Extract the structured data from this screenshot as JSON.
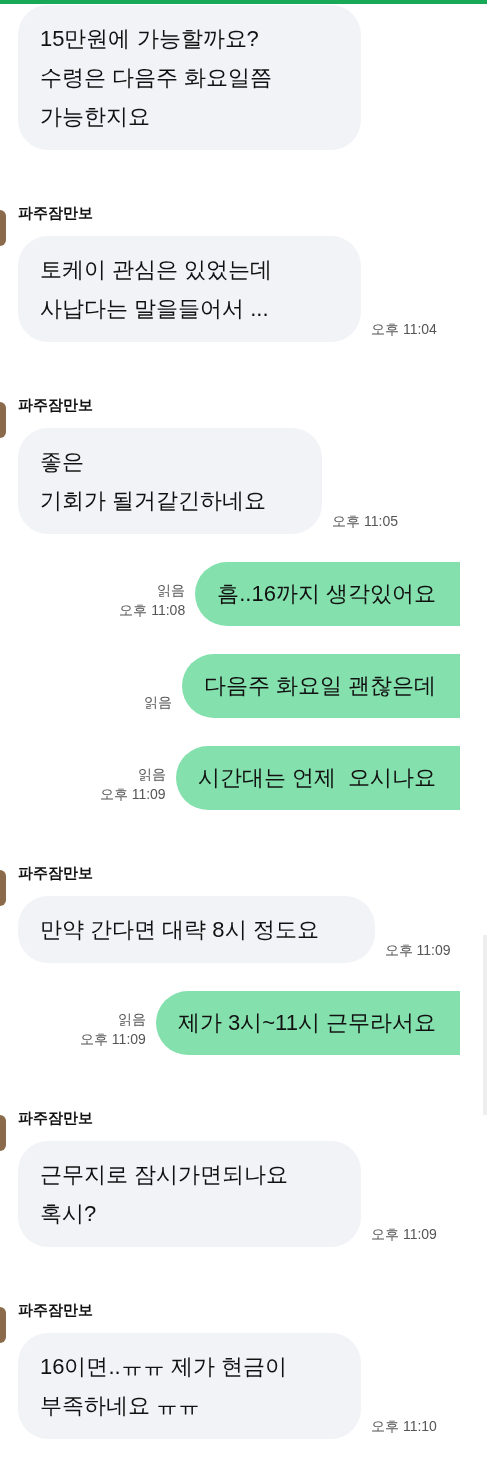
{
  "messages": [
    {
      "kind": "incoming",
      "lines": [
        "15만원에 가능할까요?",
        "수령은 다음주 화요일쯤",
        "가능한지요"
      ]
    },
    {
      "kind": "incoming",
      "sender": "파주잠만보",
      "lines": [
        "토케이 관심은 있었는데",
        "사납다는 말을들어서 ..."
      ],
      "time": "오후 11:04"
    },
    {
      "kind": "incoming",
      "sender": "파주잠만보",
      "lines": [
        "좋은",
        "기회가 될거같긴하네요"
      ],
      "time": "오후 11:05"
    },
    {
      "kind": "outgoing",
      "lines": [
        "흠..16까지 생각있어요"
      ],
      "read": "읽음",
      "time": "오후 11:08"
    },
    {
      "kind": "outgoing",
      "lines": [
        "다음주 화요일 괜찮은데"
      ],
      "read": "읽음"
    },
    {
      "kind": "outgoing",
      "lines": [
        "시간대는 언제  오시나요"
      ],
      "read": "읽음",
      "time": "오후 11:09"
    },
    {
      "kind": "incoming",
      "sender": "파주잠만보",
      "lines": [
        "만약 간다면 대략 8시 정도요"
      ],
      "time": "오후 11:09"
    },
    {
      "kind": "outgoing",
      "lines": [
        "제가 3시~11시 근무라서요"
      ],
      "read": "읽음",
      "time": "오후 11:09"
    },
    {
      "kind": "incoming",
      "sender": "파주잠만보",
      "lines": [
        "근무지로 잠시가면되나요",
        "혹시?"
      ],
      "time": "오후 11:09"
    },
    {
      "kind": "incoming",
      "sender": "파주잠만보",
      "lines": [
        "16이면..ㅠㅠ 제가 현금이",
        "부족하네요 ㅠㅠ"
      ],
      "time": "오후 11:10"
    }
  ]
}
